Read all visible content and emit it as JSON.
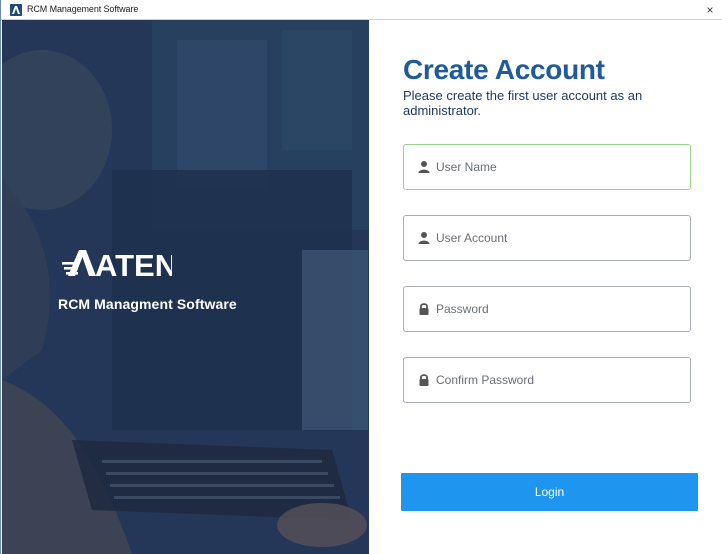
{
  "window": {
    "title": "RCM Management Software",
    "close_glyph": "×"
  },
  "brand": {
    "logo_text": "ATEN",
    "product_name": "RCM Managment Software"
  },
  "form": {
    "heading": "Create Account",
    "subheading": "Please create the first user account as an administrator.",
    "fields": [
      {
        "placeholder": "User Name",
        "icon": "user-icon",
        "focused": true
      },
      {
        "placeholder": "User Account",
        "icon": "user-icon",
        "focused": false
      },
      {
        "placeholder": "Password",
        "icon": "lock-icon",
        "focused": false
      },
      {
        "placeholder": "Confirm Password",
        "icon": "lock-icon",
        "focused": false
      }
    ],
    "submit_label": "Login"
  },
  "colors": {
    "heading": "#1f5a9c",
    "button": "#1e96f0",
    "focus_border": "#9ad38a",
    "panel_bg": "#2a3f5c"
  }
}
